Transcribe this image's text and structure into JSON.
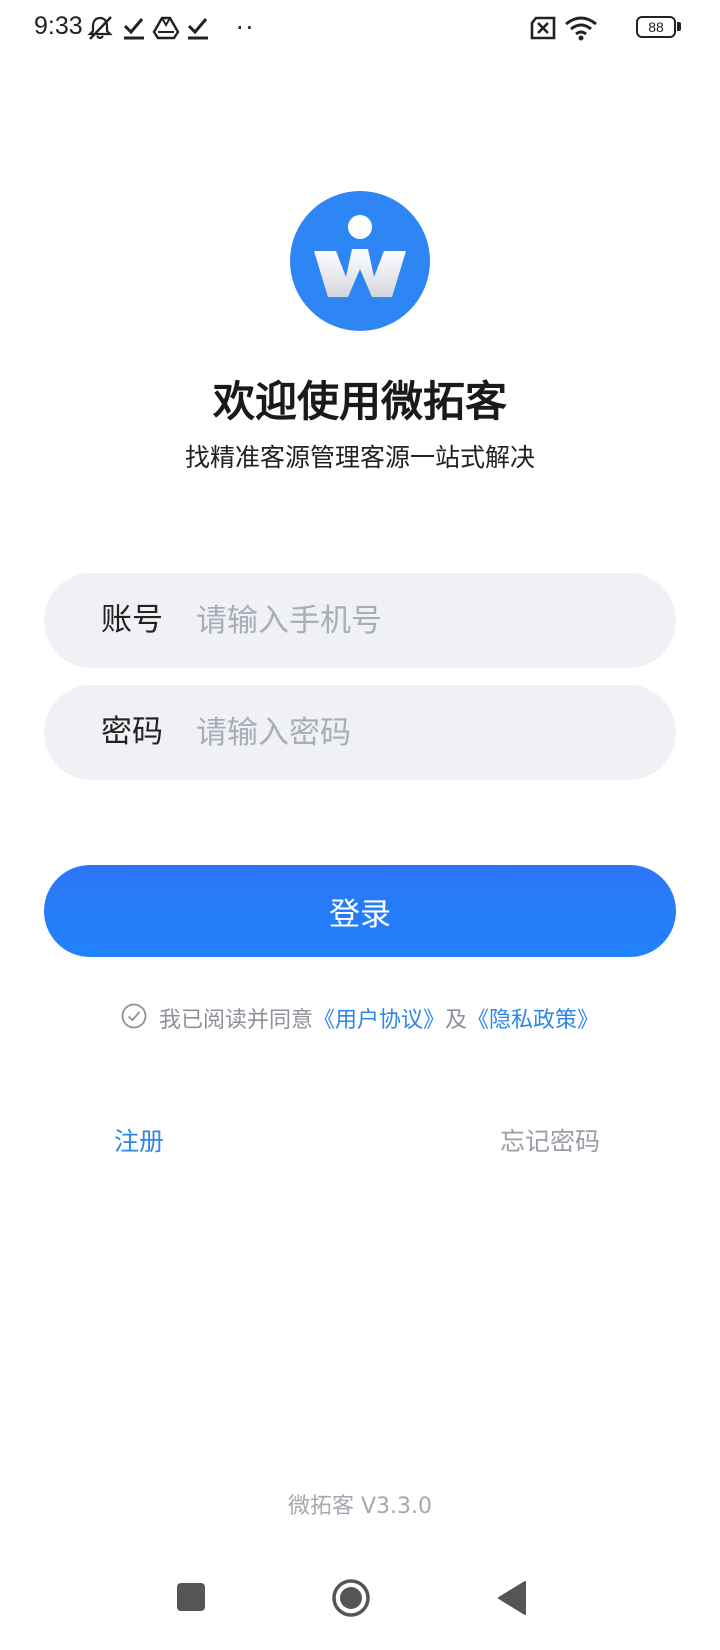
{
  "status_bar": {
    "time": "9:33",
    "icons": [
      "bell-off-icon",
      "check-download-icon",
      "drive-icon",
      "check-download-icon",
      "more-dots-icon",
      "sim-x-icon",
      "wifi-icon",
      "battery-icon"
    ],
    "dots": "··",
    "battery_level": "88"
  },
  "logo": {
    "icon": "weituoke-logo-icon",
    "color": "#2e86f5"
  },
  "welcome": {
    "title": "欢迎使用微拓客",
    "subtitle": "找精准客源管理客源一站式解决"
  },
  "form": {
    "account": {
      "label": "账号",
      "placeholder": "请输入手机号",
      "value": ""
    },
    "password": {
      "label": "密码",
      "placeholder": "请输入密码",
      "value": ""
    },
    "login_label": "登录"
  },
  "agreement": {
    "prefix": "我已阅读并同意",
    "user_agreement": "《用户协议》",
    "and": "及",
    "privacy_policy": "《隐私政策》"
  },
  "links": {
    "register": "注册",
    "forgot_password": "忘记密码"
  },
  "footer": {
    "version": "微拓客 V3.3.0"
  },
  "nav": {
    "icons": [
      "recents-square-icon",
      "home-circle-icon",
      "back-triangle-icon"
    ]
  },
  "colors": {
    "accent": "#2e86f5",
    "link": "#2e86e8",
    "field_bg": "#f0f1f5",
    "button": "#2c75f7"
  }
}
